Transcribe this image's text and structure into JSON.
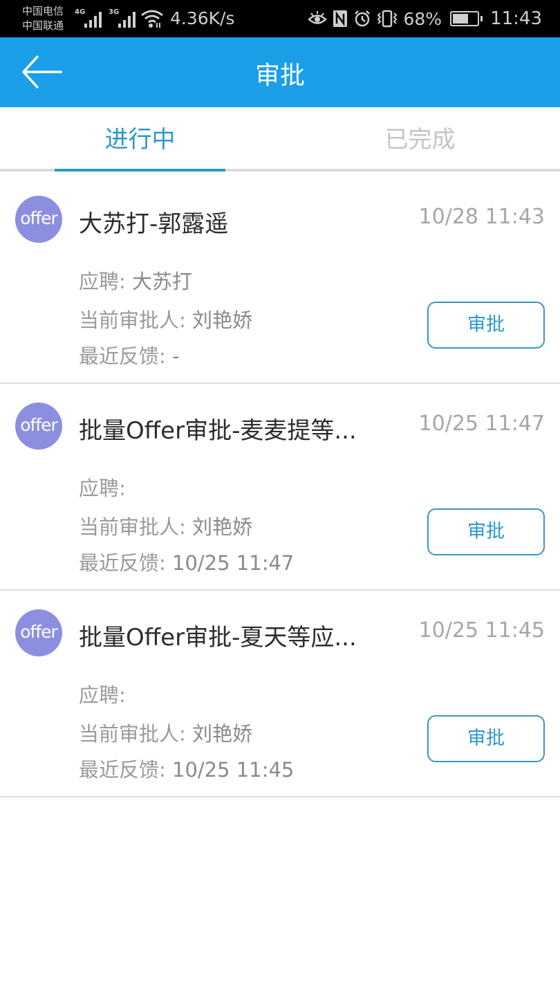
{
  "status_bar": {
    "carrier_1": "中国电信",
    "carrier_2": "中国联通",
    "network_1": "4G",
    "network_2": "3G",
    "net_speed": "4.36K/s",
    "icons": [
      "eye-icon",
      "nfc-icon",
      "alarm-icon",
      "vibrate-icon"
    ],
    "battery_percent": "68%",
    "battery_level": 0.68,
    "time": "11:43"
  },
  "header": {
    "back_icon": "arrow-left-icon",
    "title": "审批"
  },
  "tabs": [
    {
      "label": "进行中",
      "active": true
    },
    {
      "label": "已完成",
      "active": false
    }
  ],
  "colors": {
    "header_bg": "#1a9fe8",
    "accent": "#2b97cc",
    "avatar_bg": "#8c8fe0"
  },
  "items": [
    {
      "avatar_text": "offer",
      "title": "大苏打-郭露遥",
      "time": "10/28 11:43",
      "position_label": "应聘: ",
      "position_value": "大苏打",
      "approver_label": "当前审批人: ",
      "approver_value": "刘艳娇",
      "feedback_label": "最近反馈: ",
      "feedback_value": "-",
      "button": "审批"
    },
    {
      "avatar_text": "offer",
      "title": "批量Offer审批-麦麦提等应聘者",
      "title_display": "批量Offer审批-麦麦提等...",
      "time": "10/25 11:47",
      "position_label": "应聘: ",
      "position_value": "",
      "approver_label": "当前审批人: ",
      "approver_value": "刘艳娇",
      "feedback_label": "最近反馈: ",
      "feedback_value": "10/25 11:47",
      "button": "审批"
    },
    {
      "avatar_text": "offer",
      "title": "批量Offer审批-夏天等应聘者",
      "title_display": "批量Offer审批-夏天等应...",
      "time": "10/25 11:45",
      "position_label": "应聘: ",
      "position_value": "",
      "approver_label": "当前审批人: ",
      "approver_value": "刘艳娇",
      "feedback_label": "最近反馈: ",
      "feedback_value": "10/25 11:45",
      "button": "审批"
    }
  ]
}
